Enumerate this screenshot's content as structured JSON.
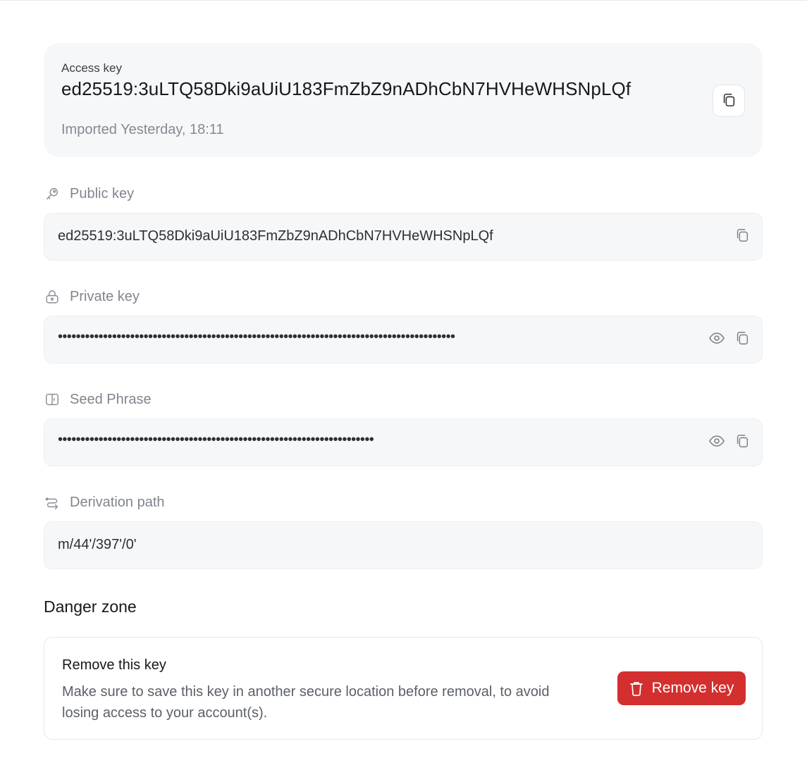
{
  "access_key": {
    "label": "Access key",
    "value": "ed25519:3uLTQ58Dki9aUiU183FmZbZ9nADhCbN7HVHeWHSNpLQf",
    "meta": "Imported Yesterday, 18:11",
    "copy_icon": "copy-icon"
  },
  "fields": {
    "public_key": {
      "label": "Public key",
      "icon": "key-icon",
      "value": "ed25519:3uLTQ58Dki9aUiU183FmZbZ9nADhCbN7HVHeWHSNpLQf"
    },
    "private_key": {
      "label": "Private key",
      "icon": "lock-icon",
      "masked_value": "••••••••••••••••••••••••••••••••••••••••••••••••••••••••••••••••••••••••••••••••••••••••"
    },
    "seed_phrase": {
      "label": "Seed Phrase",
      "icon": "book-icon",
      "masked_value": "••••••••••••••••••••••••••••••••••••••••••••••••••••••••••••••••••••••"
    },
    "derivation_path": {
      "label": "Derivation path",
      "icon": "route-icon",
      "value": "m/44'/397'/0'"
    }
  },
  "danger_zone": {
    "title": "Danger zone",
    "heading": "Remove this key",
    "description": "Make sure to save this key in another secure location before removal, to avoid losing access to your account(s).",
    "button_label": "Remove key",
    "button_icon": "trash-icon"
  },
  "colors": {
    "danger": "#d32f2f",
    "card_bg": "#f6f7f9",
    "muted_text": "#80858e"
  }
}
